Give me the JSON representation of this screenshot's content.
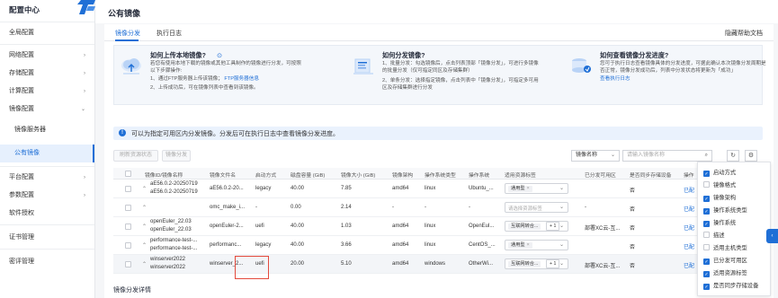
{
  "sidebar": {
    "title": "配置中心",
    "items": [
      {
        "label": "全局配置"
      },
      {
        "label": "网络配置"
      },
      {
        "label": "存储配置"
      },
      {
        "label": "计算配置"
      },
      {
        "label": "镜像配置"
      },
      {
        "label": "镜像服务器"
      },
      {
        "label": "公有镜像"
      },
      {
        "label": "平台配置"
      },
      {
        "label": "参数配置"
      },
      {
        "label": "软件授权"
      },
      {
        "label": "证书管理"
      },
      {
        "label": "密评管理"
      }
    ]
  },
  "badge": "!",
  "header": {
    "title": "公有镜像"
  },
  "tabs": [
    {
      "label": "镜像分发"
    },
    {
      "label": "执行日志"
    }
  ],
  "help_link": "隐藏帮助文档",
  "info_cards": [
    {
      "title": "如何上传本地镜像?",
      "lines": [
        "若您有使用本地下载的镜像或其他工具制作的镜像进行分发，可按照",
        "以下步骤操作:",
        "1、通过FTP服务器上传该镜像；",
        "2、上传成功后，可在镜像列表中查看到该镜像。"
      ],
      "link": "FTP服务器信息"
    },
    {
      "title": "如何分发镜像?",
      "lines": [
        "1、批量分发：勾选镜像后，点击列表顶部「镜像分发」，可进行多镜像",
        "的批量分发（仅可指定同区及存储集群）",
        "2、单条分发：选择指定镜像，点击列表中「镜像分发」，可指定多可用",
        "区及存储集群进行分发"
      ]
    },
    {
      "title": "如何查看镜像分发进度?",
      "lines": [
        "您可于执行日志查看镜像具体的分发进度，可据此确认本次镜像分发周期是",
        "否正常，镜像分发成功后，列表中分发状态将更新为「成功」"
      ],
      "link": "查看执行日志"
    }
  ],
  "notice": "可以为指定可用区内分发镜像。分发后可在执行日志中查看镜像分发进度。",
  "toolbar": {
    "btn1": "刷新资源状态",
    "btn2": "镜像分发",
    "filter_select": "镜像名称",
    "search_placeholder": "请输入镜像名称"
  },
  "table": {
    "headers": [
      "镜像ID/镜像名称",
      "镜像文件名",
      "启动方式",
      "磁盘容量 (GiB)",
      "镜像大小 (GiB)",
      "镜像架构",
      "操作系统类型",
      "操作系统",
      "适用资源标签",
      "已分发可用区",
      "是否同步存储设备",
      "操作"
    ],
    "rows": [
      {
        "id_name": [
          "aE56.0.2-20250719",
          "aE56.0.2-20250719"
        ],
        "file": "aE56.0.2-20...",
        "boot": "legacy",
        "disk": "40.00",
        "size": "7.85",
        "arch": "amd64",
        "ostype": "linux",
        "os": "Ubuntu_...",
        "tag": "通用型",
        "tag_placeholder": "",
        "plus": "",
        "zone": "",
        "sync": "否",
        "op": "已配"
      },
      {
        "id_name": [
          "",
          ""
        ],
        "file": "omc_make_i...",
        "boot": "-",
        "disk": "0.00",
        "size": "2.14",
        "arch": "-",
        "ostype": "-",
        "os": "-",
        "tag": "",
        "tag_placeholder": "请选择资源标签",
        "plus": "",
        "zone": "-",
        "sync": "否",
        "op": "已配"
      },
      {
        "id_name": [
          "openEuler_22.03",
          "openEuler_22.03"
        ],
        "file": "openEuler-2...",
        "boot": "uefi",
        "disk": "40.00",
        "size": "1.03",
        "arch": "amd64",
        "ostype": "linux",
        "os": "OpenEul...",
        "tag": "互联网转合...",
        "tag_placeholder": "",
        "plus": "+ 1",
        "zone": "部署XC云-互...",
        "sync": "否",
        "op": "已配"
      },
      {
        "id_name": [
          "performance-test-...",
          "performance-test-..."
        ],
        "file": "performanc...",
        "boot": "legacy",
        "disk": "40.00",
        "size": "3.66",
        "arch": "amd64",
        "ostype": "linux",
        "os": "CentOS_...",
        "tag": "通用型",
        "tag_placeholder": "",
        "plus": "",
        "zone": "",
        "sync": "否",
        "op": "已配"
      },
      {
        "id_name": [
          "winserver2022",
          "winserver2022"
        ],
        "file": "winserver_2...",
        "boot": "uefi",
        "disk": "20.00",
        "size": "5.10",
        "arch": "amd64",
        "ostype": "windows",
        "os": "OtherWi...",
        "tag": "互联网转合...",
        "tag_placeholder": "",
        "plus": "+ 1",
        "zone": "部署XC云-互...",
        "sync": "否",
        "op": "已配"
      }
    ]
  },
  "detail_title": "镜像分发详情",
  "column_settings": [
    {
      "label": "启动方式",
      "checked": true
    },
    {
      "label": "镜像格式",
      "checked": false
    },
    {
      "label": "镜像架构",
      "checked": true
    },
    {
      "label": "操作系统类型",
      "checked": true
    },
    {
      "label": "操作系统",
      "checked": true
    },
    {
      "label": "描述",
      "checked": false
    },
    {
      "label": "适用主机类型",
      "checked": false
    },
    {
      "label": "已分发可用区",
      "checked": true
    },
    {
      "label": "适用资源标签",
      "checked": true
    },
    {
      "label": "是否同步存储设备",
      "checked": true
    }
  ],
  "colors": {
    "accent": "#1f6fd6",
    "highlight": "#e34a3c",
    "badge": "#e0432a"
  }
}
